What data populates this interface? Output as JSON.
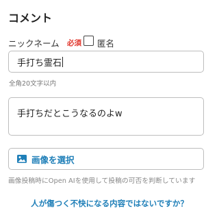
{
  "section_title": "コメント",
  "nickname": {
    "label": "ニックネーム",
    "required_badge": "必須",
    "anonymous_label": "匿名",
    "value": "手打ち霊石",
    "hint": "全角20文字以内"
  },
  "comment": {
    "value": "手打ちだとこうなるのよw"
  },
  "image_button": {
    "label": "画像を選択",
    "icon": "image-icon"
  },
  "note": "画像投稿時にOpen AIを使用して投稿の可否を判断しています",
  "help_link": "人が傷つく不快になる内容ではないですか？",
  "colors": {
    "required": "#e0352b",
    "accent": "#1f7fb8"
  }
}
